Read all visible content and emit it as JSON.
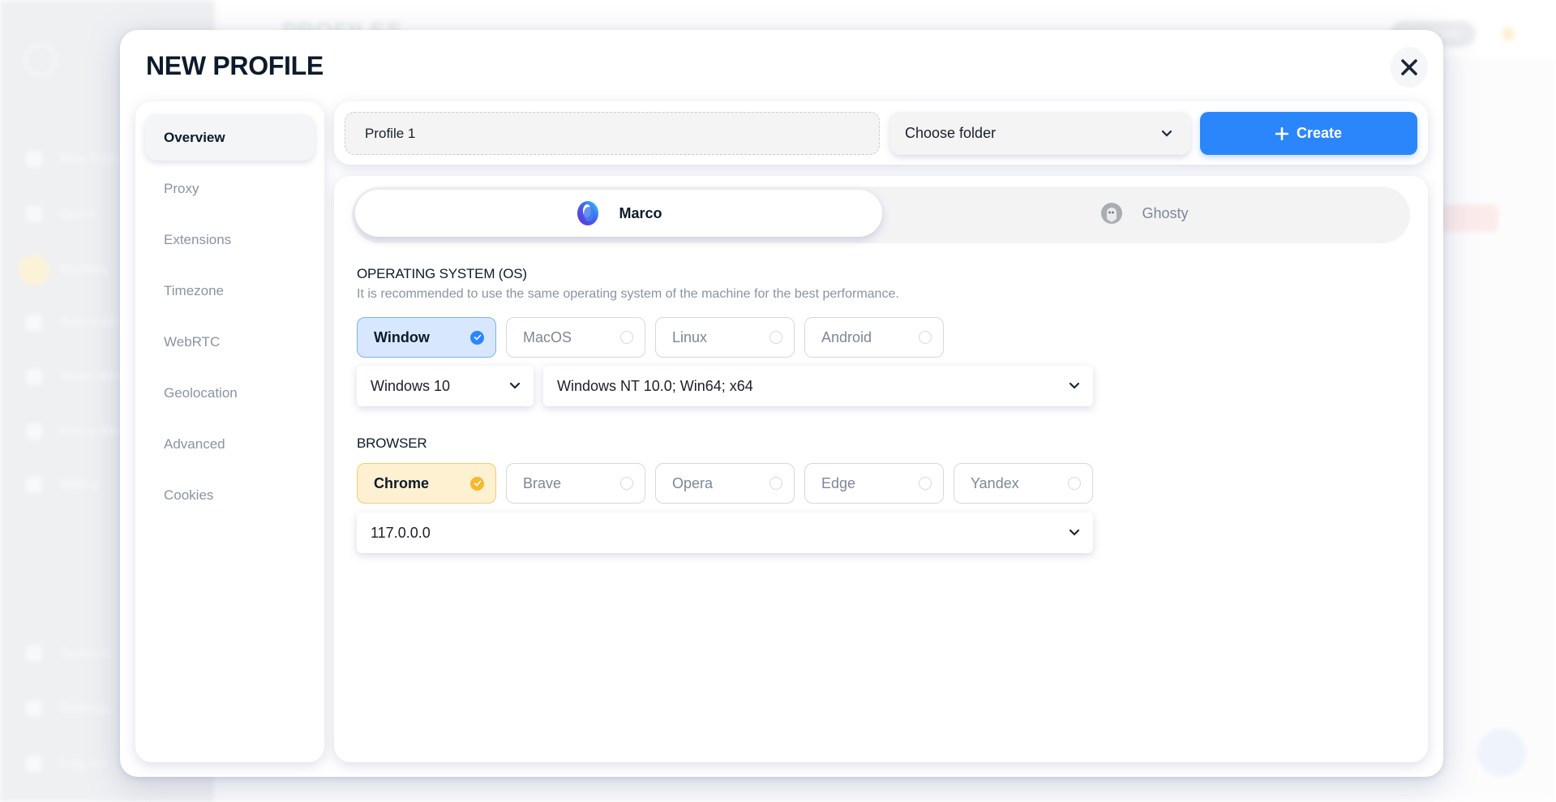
{
  "background": {
    "page_title": "PROFILES",
    "nav": [
      "New Profile",
      "Quick",
      "Profiles",
      "Automation",
      "Team Member",
      "Proxy Manager",
      "Billing",
      "Support",
      "Settings",
      "Log out"
    ],
    "pill_label": "Enter Code",
    "coin_count": "0",
    "stop_label": "Stop"
  },
  "modal": {
    "title": "NEW PROFILE",
    "close_icon": "close-icon"
  },
  "sidebar": {
    "items": [
      {
        "label": "Overview",
        "active": true
      },
      {
        "label": "Proxy"
      },
      {
        "label": "Extensions"
      },
      {
        "label": "Timezone"
      },
      {
        "label": "WebRTC"
      },
      {
        "label": "Geolocation"
      },
      {
        "label": "Advanced"
      },
      {
        "label": "Cookies"
      }
    ]
  },
  "toolbar": {
    "profile_name_value": "Profile 1",
    "folder_placeholder": "Choose folder",
    "create_label": "Create",
    "accent_color": "#2b86fb"
  },
  "engines": [
    {
      "label": "Marco",
      "active": true,
      "icon": "marco-browser-icon"
    },
    {
      "label": "Ghosty",
      "active": false,
      "icon": "ghosty-browser-icon"
    }
  ],
  "os": {
    "title": "OPERATING SYSTEM (OS)",
    "subtitle": "It is recommended to use the same operating system of the machine for the best performance.",
    "options": [
      {
        "label": "Window",
        "selected": true
      },
      {
        "label": "MacOS",
        "selected": false
      },
      {
        "label": "Linux",
        "selected": false
      },
      {
        "label": "Android",
        "selected": false
      }
    ],
    "version_value": "Windows 10",
    "platform_value": "Windows NT 10.0; Win64; x64",
    "selected_color": "#2b86fb"
  },
  "browser": {
    "title": "BROWSER",
    "options": [
      {
        "label": "Chrome",
        "selected": true
      },
      {
        "label": "Brave",
        "selected": false
      },
      {
        "label": "Opera",
        "selected": false
      },
      {
        "label": "Edge",
        "selected": false
      },
      {
        "label": "Yandex",
        "selected": false
      }
    ],
    "version_value": "117.0.0.0",
    "selected_color": "#f5b82e"
  }
}
